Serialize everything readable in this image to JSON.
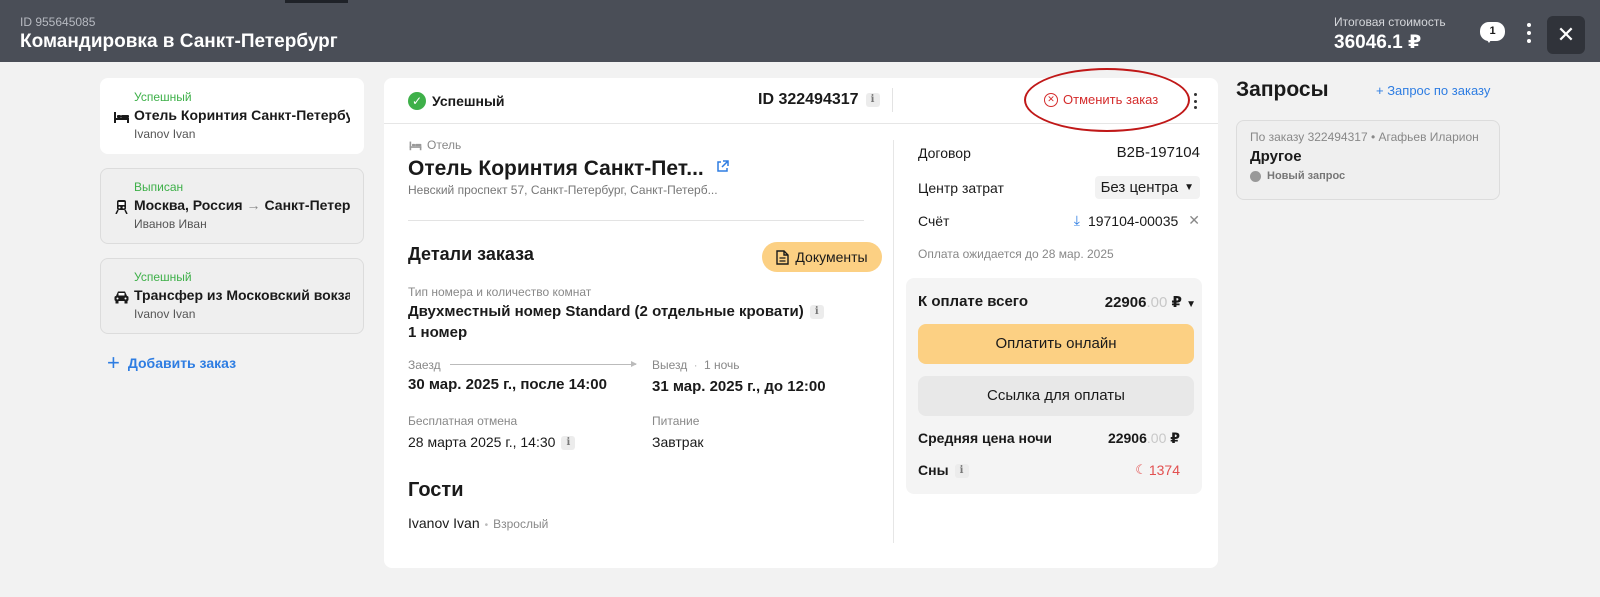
{
  "header": {
    "trip_id": "ID 955645085",
    "trip_title": "Командировка в Санкт-Петербург",
    "total_label": "Итоговая стоимость",
    "total_value": "36046.1 ₽",
    "chat_count": "1",
    "close_glyph": "✕"
  },
  "orders": [
    {
      "status": "Успешный",
      "status_color": "#3eb049",
      "icon": "bed-icon",
      "title": "Отель Коринтия Санкт-Петербург",
      "person": "Ivanov Ivan"
    },
    {
      "status": "Выписан",
      "status_color": "#3eb049",
      "icon": "train-icon",
      "from": "Москва, Россия",
      "arrow": "→",
      "to": "Санкт-Петербург",
      "person": "Иванов Иван"
    },
    {
      "status": "Успешный",
      "status_color": "#3eb049",
      "icon": "car-icon",
      "title": "Трансфер из Московский вокзал",
      "person": "Ivanov Ivan"
    }
  ],
  "add_order_label": "Добавить заказ",
  "main": {
    "status_label": "Успешный",
    "order_id": "ID 322494317",
    "cancel_label": "Отменить заказ",
    "hotel_kind": "Отель",
    "hotel_name": "Отель Коринтия Санкт-Пет...",
    "hotel_address": "Невский проспект 57, Санкт-Петербург, Санкт-Петерб...",
    "details_title": "Детали заказа",
    "documents_label": "Документы",
    "room_type_label": "Тип номера и количество комнат",
    "room_type_value": "Двухместный номер Standard (2 отдельные кровати)",
    "room_count": "1 номер",
    "checkin_label": "Заезд",
    "checkout_label": "Выезд",
    "nights": "1 ночь",
    "checkin_value": "30 мар. 2025 г., после 14:00",
    "checkout_value": "31 мар. 2025 г., до 12:00",
    "free_cancel_label": "Бесплатная отмена",
    "free_cancel_value": "28 марта 2025 г., 14:30",
    "meal_label": "Питание",
    "meal_value": "Завтрак",
    "guests_title": "Гости",
    "guest_name": "Ivanov Ivan",
    "guest_role": "Взрослый"
  },
  "side": {
    "contract_label": "Договор",
    "contract_value": "B2B-197104",
    "cost_center_label": "Центр затрат",
    "cost_center_value": "Без центра",
    "invoice_label": "Счёт",
    "invoice_value": "197104-00035",
    "payment_note": "Оплата ожидается до 28 мар. 2025",
    "total_due_label": "К оплате всего",
    "total_due_int": "22906",
    "total_due_dec": ".00",
    "currency": "₽",
    "pay_online_label": "Оплатить онлайн",
    "pay_link_label": "Ссылка для оплаты",
    "avg_night_label": "Средняя цена ночи",
    "avg_night_int": "22906",
    "avg_night_dec": ".00",
    "sny_label": "Сны",
    "sny_value": "1374"
  },
  "requests": {
    "title": "Запросы",
    "add_label": "+ Запрос по заказу",
    "items": [
      {
        "meta": "По заказу 322494317 • Агафьев Иларион",
        "subject": "Другое",
        "state": "Новый запрос"
      }
    ]
  },
  "colors": {
    "header_bg": "#4a4e57",
    "accent_yellow": "#fcd083",
    "link_blue": "#2e7de2",
    "success_green": "#3eb049",
    "danger_red": "#d42c2c"
  }
}
